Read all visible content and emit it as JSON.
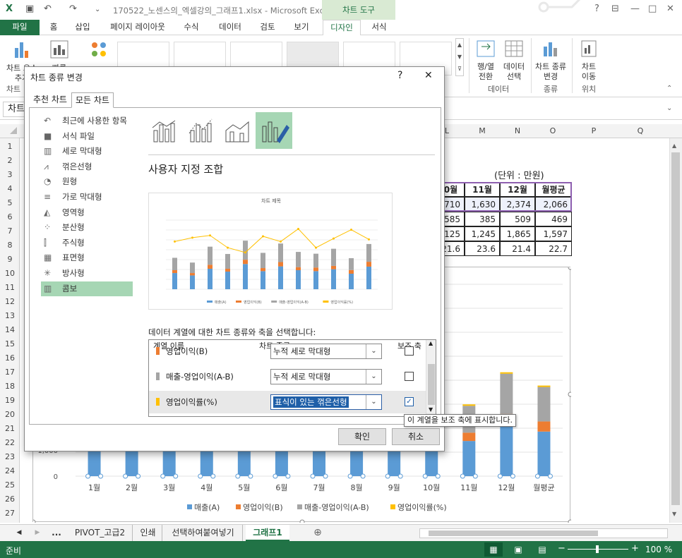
{
  "window": {
    "title": "170522_노센스의_엑셀강의_그래프1.xlsx - Microsoft Excel",
    "context_tools": "차트 도구",
    "help": "?",
    "minimize": "—",
    "restore": "□",
    "close": "✕"
  },
  "ribbon_tabs": [
    "파일",
    "홈",
    "삽입",
    "페이지 레이아웃",
    "수식",
    "데이터",
    "검토",
    "보기",
    "디자인",
    "서식"
  ],
  "ribbon": {
    "add_element_1": "차트 요소",
    "add_element_2": "추가",
    "quick_layout": "빠른",
    "change_colors": "색 변경",
    "group_chart_layouts": "차트",
    "switch_row_col_1": "행/열",
    "switch_row_col_2": "전환",
    "select_data_1": "데이터",
    "select_data_2": "선택",
    "change_type_1": "차트 종류",
    "change_type_2": "변경",
    "move_chart_1": "차트",
    "move_chart_2": "이동",
    "group_data": "데이터",
    "group_type": "종류",
    "group_location": "위치"
  },
  "formula_bar": {
    "name_box": "차트",
    "formula_tail": ")"
  },
  "columns": [
    "L",
    "M",
    "N",
    "O",
    "P",
    "Q"
  ],
  "rows": [
    "1",
    "2",
    "3",
    "4",
    "5",
    "6",
    "7",
    "8",
    "9",
    "10",
    "11",
    "12",
    "13",
    "14",
    "15",
    "16",
    "17",
    "18",
    "19",
    "20",
    "21",
    "22",
    "23",
    "24",
    "25",
    "26",
    "27"
  ],
  "table": {
    "unit": "(단위 : 만원)",
    "headers": [
      "0월",
      "11월",
      "12월",
      "월평균"
    ],
    "rows": [
      [
        "710",
        "1,630",
        "2,374",
        "2,066"
      ],
      [
        "585",
        "385",
        "509",
        "469"
      ],
      [
        "125",
        "1,245",
        "1,865",
        "1,597"
      ],
      [
        "21.6",
        "23.6",
        "21.4",
        "22.7"
      ]
    ]
  },
  "sheet_tabs": [
    "...",
    "PIVOT_고급2",
    "인쇄",
    "선택하여붙여넣기",
    "그래프1"
  ],
  "status": {
    "ready": "준비",
    "zoom": "100 %"
  },
  "dialog": {
    "title": "차트 종류 변경",
    "help": "?",
    "close": "✕",
    "tab_recommended": "추천 차트",
    "tab_all": "모든 차트",
    "chart_types": [
      {
        "label": "최근에 사용한 항목",
        "icon": "undo-icon",
        "glyph": "↶"
      },
      {
        "label": "서식 파일",
        "icon": "folder-icon",
        "glyph": "■"
      },
      {
        "label": "세로 막대형",
        "icon": "column-chart-icon",
        "glyph": "▥"
      },
      {
        "label": "꺾은선형",
        "icon": "line-chart-icon",
        "glyph": "⩘"
      },
      {
        "label": "원형",
        "icon": "pie-chart-icon",
        "glyph": "◔"
      },
      {
        "label": "가로 막대형",
        "icon": "bar-chart-icon",
        "glyph": "≡"
      },
      {
        "label": "영역형",
        "icon": "area-chart-icon",
        "glyph": "◭"
      },
      {
        "label": "분산형",
        "icon": "scatter-chart-icon",
        "glyph": "⁘"
      },
      {
        "label": "주식형",
        "icon": "stock-chart-icon",
        "glyph": "⫿"
      },
      {
        "label": "표면형",
        "icon": "surface-chart-icon",
        "glyph": "▦"
      },
      {
        "label": "방사형",
        "icon": "radar-chart-icon",
        "glyph": "✳"
      },
      {
        "label": "콤보",
        "icon": "combo-chart-icon",
        "glyph": "▥"
      }
    ],
    "selected_type_index": 11,
    "subtype_title": "사용자 지정 조합",
    "preview_title": "차트 제목",
    "series_prompt": "데이터 계열에 대한 차트 종류와 축을 선택합니다:",
    "grid_headers": {
      "name": "계열 이름",
      "type": "차트 종류",
      "secondary": "보조 축"
    },
    "series": [
      {
        "name": "영업이익(B)",
        "type": "누적 세로 막대형",
        "secondary": false,
        "color": "#ed7d31"
      },
      {
        "name": "매출-영업이익(A-B)",
        "type": "누적 세로 막대형",
        "secondary": false,
        "color": "#a5a5a5"
      },
      {
        "name": "영업이익률(%)",
        "type": "표식이 있는 꺾은선형",
        "secondary": true,
        "color": "#ffc000"
      }
    ],
    "tooltip": "이 계열을 보조 축에 표시합니다.",
    "ok": "확인",
    "cancel": "취소"
  },
  "chart_data": {
    "type": "bar",
    "categories": [
      "1월",
      "2월",
      "3월",
      "4월",
      "5월",
      "6월",
      "7월",
      "8월",
      "9월",
      "10월",
      "11월",
      "12월",
      "월평균"
    ],
    "ylabel_ticks": [
      "0",
      "1,000"
    ],
    "series": [
      {
        "name": "매출(A)",
        "color": "#5b9bd5",
        "values": [
          1700,
          1450,
          2150,
          1850,
          2650,
          1900,
          2400,
          2000,
          1900,
          2100,
          1630,
          2374,
          2066
        ]
      },
      {
        "name": "영업이익(B)",
        "color": "#ed7d31",
        "values": [
          300,
          250,
          420,
          300,
          450,
          320,
          450,
          320,
          380,
          350,
          385,
          509,
          469
        ]
      },
      {
        "name": "매출-영업이익(A-B)",
        "color": "#a5a5a5",
        "values": [
          1300,
          1100,
          1900,
          1550,
          2000,
          1600,
          1950,
          1600,
          1450,
          1800,
          1245,
          1865,
          1597
        ]
      },
      {
        "name": "영업이익률(%)",
        "color": "#ffc000",
        "values": [
          20.9,
          21.8,
          22.3,
          19.5,
          18.4,
          22.1,
          20.9,
          23.8,
          19.5,
          21.6,
          23.6,
          21.4,
          22.7
        ]
      }
    ]
  }
}
